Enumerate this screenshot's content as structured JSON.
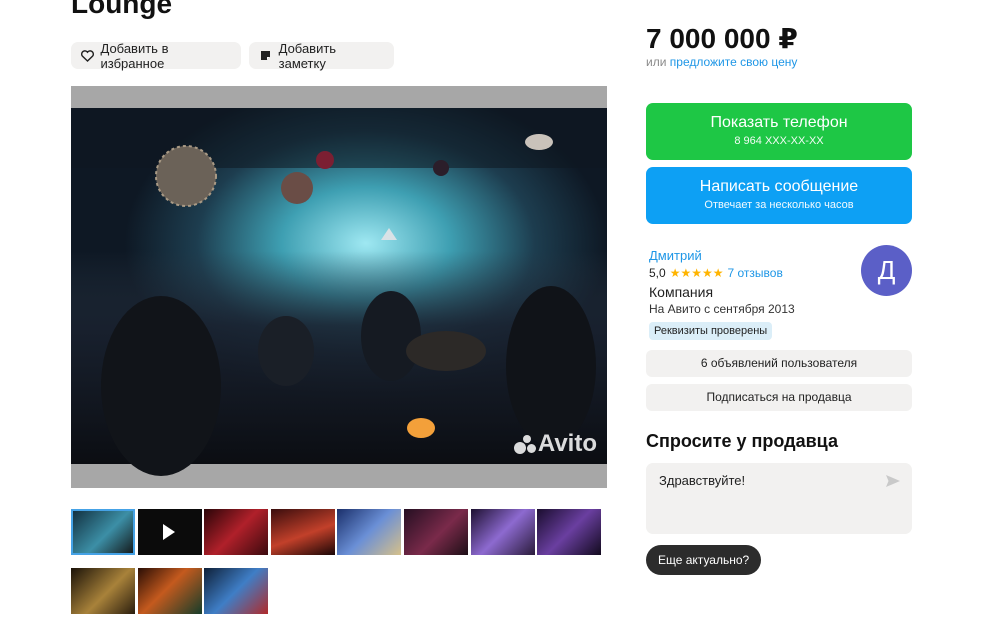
{
  "listing": {
    "title": "Lounge",
    "favorite_label": "Добавить в избранное",
    "note_label": "Добавить заметку",
    "watermark": "Avito",
    "thumb_count": 11
  },
  "sidebar": {
    "price": "7 000 000 ₽",
    "offer_prefix": "или",
    "offer_link": "предложите свою цену",
    "show_phone": {
      "label": "Показать телефон",
      "phone": "8 964 XXX-XX-XX"
    },
    "write_message": {
      "label": "Написать сообщение",
      "sub": "Отвечает за несколько часов"
    },
    "seller": {
      "name": "Дмитрий",
      "rating": "5,0",
      "stars": "★★★★★",
      "reviews": "7 отзывов",
      "type": "Компания",
      "since": "На Авито с сентября 2013",
      "verified": "Реквизиты проверены",
      "avatar_letter": "Д",
      "avatar_color": "#5b5fc7"
    },
    "ads_button": "6 объявлений пользователя",
    "subscribe_button": "Подписаться на продавца",
    "ask_title": "Спросите у продавца",
    "message_text": "Здравствуйте!",
    "still_actual": "Еще актуально?"
  },
  "colors": {
    "green": "#1ec745",
    "blue": "#0da0f4",
    "link": "#1e96e6"
  }
}
